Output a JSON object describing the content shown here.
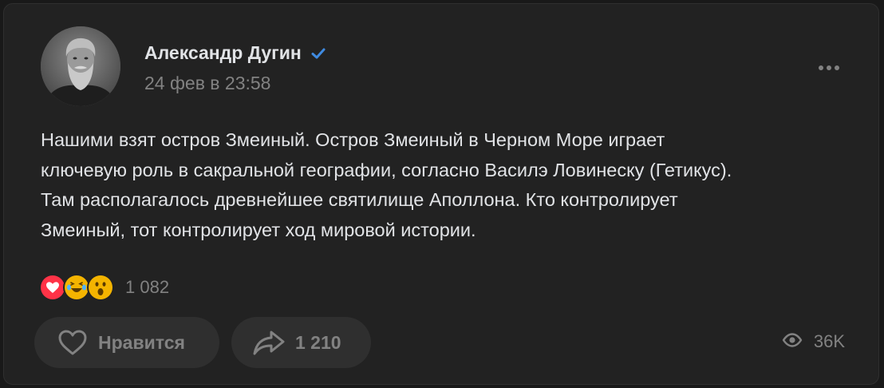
{
  "post": {
    "author": "Александр Дугин",
    "date": "24 фев в 23:58",
    "text": "Нашими взят остров Змеиный. Остров Змеиный в Черном Море играет\nключевую роль в сакральной географии, согласно Василэ Ловинеску (Гетикус).\nТам располагалось древнейшее святилище Аполлона. Кто контролирует\nЗмеиный, тот контролирует ход мировой истории."
  },
  "reactions": {
    "icons": [
      "heart-reaction",
      "laughing-tears-reaction",
      "surprised-reaction"
    ],
    "count": "1 082"
  },
  "actions": {
    "like_label": "Нравится",
    "share_count": "1 210"
  },
  "views": {
    "count": "36K"
  },
  "colors": {
    "background": "#191919",
    "card": "#222222",
    "text": "#e1e3e6",
    "secondary": "#828282",
    "button": "#2f2f2f",
    "verified": "#3f8ae0",
    "heart": "#ff3347",
    "emoji": "#f4b400"
  }
}
